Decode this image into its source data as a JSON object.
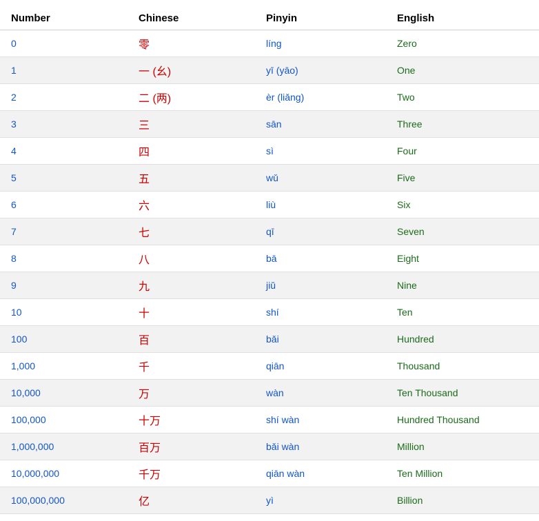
{
  "table": {
    "headers": [
      "Number",
      "Chinese",
      "Pinyin",
      "English"
    ],
    "rows": [
      {
        "number": "0",
        "chinese": "零",
        "pinyin": "líng",
        "english": "Zero"
      },
      {
        "number": "1",
        "chinese": "一 (幺)",
        "pinyin": "yī  (yāo)",
        "english": "One"
      },
      {
        "number": "2",
        "chinese": "二 (两)",
        "pinyin": "èr (liǎng)",
        "english": "Two"
      },
      {
        "number": "3",
        "chinese": "三",
        "pinyin": "sān",
        "english": "Three"
      },
      {
        "number": "4",
        "chinese": "四",
        "pinyin": "sì",
        "english": "Four"
      },
      {
        "number": "5",
        "chinese": "五",
        "pinyin": "wǔ",
        "english": "Five"
      },
      {
        "number": "6",
        "chinese": "六",
        "pinyin": "liù",
        "english": "Six"
      },
      {
        "number": "7",
        "chinese": "七",
        "pinyin": "qī",
        "english": "Seven"
      },
      {
        "number": "8",
        "chinese": "八",
        "pinyin": "bā",
        "english": "Eight"
      },
      {
        "number": "9",
        "chinese": "九",
        "pinyin": "jiǔ",
        "english": "Nine"
      },
      {
        "number": "10",
        "chinese": "十",
        "pinyin": "shí",
        "english": "Ten"
      },
      {
        "number": "100",
        "chinese": "百",
        "pinyin": "bǎi",
        "english": "Hundred"
      },
      {
        "number": "1,000",
        "chinese": "千",
        "pinyin": "qiān",
        "english": "Thousand"
      },
      {
        "number": "10,000",
        "chinese": "万",
        "pinyin": "wàn",
        "english": "Ten Thousand"
      },
      {
        "number": "100,000",
        "chinese": "十万",
        "pinyin": "shí wàn",
        "english": "Hundred Thousand"
      },
      {
        "number": "1,000,000",
        "chinese": "百万",
        "pinyin": "bǎi wàn",
        "english": "Million"
      },
      {
        "number": "10,000,000",
        "chinese": "千万",
        "pinyin": "qiān  wàn",
        "english": "Ten Million"
      },
      {
        "number": "100,000,000",
        "chinese": "亿",
        "pinyin": "yì",
        "english": "Billion"
      }
    ]
  }
}
